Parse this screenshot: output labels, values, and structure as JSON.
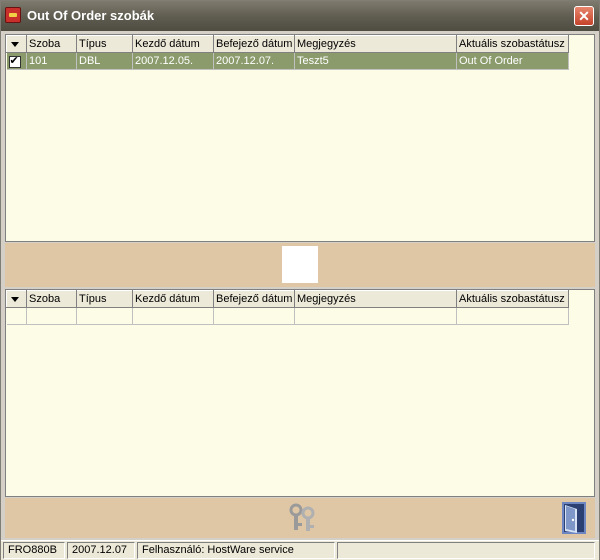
{
  "window": {
    "title": "Out Of Order szobák",
    "close_label": "✕"
  },
  "columns": [
    "Szoba",
    "Típus",
    "Kezdő dátum",
    "Befejező dátum",
    "Megjegyzés",
    "Aktuális szobastátusz"
  ],
  "top_table": {
    "rows": [
      {
        "checked": true,
        "cells": [
          "101",
          "DBL",
          "2007.12.05.",
          "2007.12.07.",
          "Teszt5",
          "Out Of Order"
        ]
      }
    ]
  },
  "bottom_table": {
    "rows": [
      {
        "checked": false,
        "cells": [
          "",
          "",
          "",
          "",
          "",
          ""
        ]
      }
    ]
  },
  "icons": {
    "app": "key-app-icon",
    "keys": "keys-icon",
    "exit": "door-exit-icon"
  },
  "status": {
    "code": "FRO880B",
    "date": "2007.12.07",
    "user": "Felhasználó: HostWare service"
  },
  "colors": {
    "grid_bg": "#fdfde7",
    "selected_row": "#8b9b6c",
    "panel": "#dfc7a6",
    "titlebar": "#5e5b4f"
  }
}
